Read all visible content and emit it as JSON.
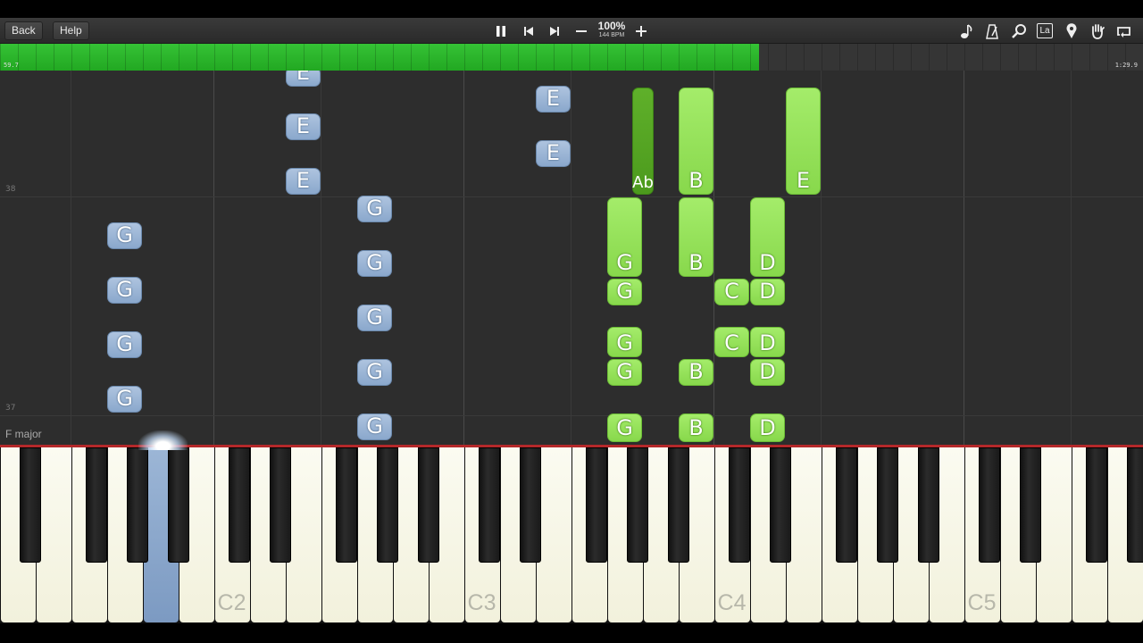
{
  "toolbar": {
    "back_label": "Back",
    "help_label": "Help",
    "tempo_percent": "100%",
    "tempo_bpm": "144 BPM",
    "icons_center": [
      "pause-icon",
      "skip-back-icon",
      "skip-forward-icon",
      "minus-icon",
      "plus-icon"
    ],
    "icons_right": [
      "note-icon",
      "metronome-icon",
      "search-icon",
      "la-label-icon",
      "map-pin-icon",
      "hand-icon",
      "loop-icon"
    ],
    "la_text": "La"
  },
  "progress": {
    "current_time": "59.7",
    "total_time": "1:29.9",
    "fraction": 0.664,
    "fill_color": "#2bb52b"
  },
  "roll": {
    "measure_numbers": [
      "38",
      "37"
    ],
    "key_signature": "F major"
  },
  "notes": {
    "blue": [
      "E",
      "E",
      "E",
      "E",
      "E",
      "G",
      "G",
      "G",
      "G",
      "G",
      "G",
      "G",
      "G",
      "G"
    ],
    "green": [
      "Ab",
      "B",
      "E",
      "G",
      "B",
      "D",
      "G",
      "C",
      "D",
      "G",
      "C",
      "D",
      "G",
      "B",
      "D",
      "G",
      "B",
      "D"
    ]
  },
  "keyboard": {
    "octave_labels": [
      "C2",
      "C3",
      "C4",
      "C5"
    ],
    "pressed_key": "G1"
  },
  "colors": {
    "blue_note": "#9bb6d7",
    "green_note": "#97e35a",
    "dark_green_note": "#55a624",
    "pressed_key": "#8aa8cc",
    "hit_line": "#b4282a"
  }
}
